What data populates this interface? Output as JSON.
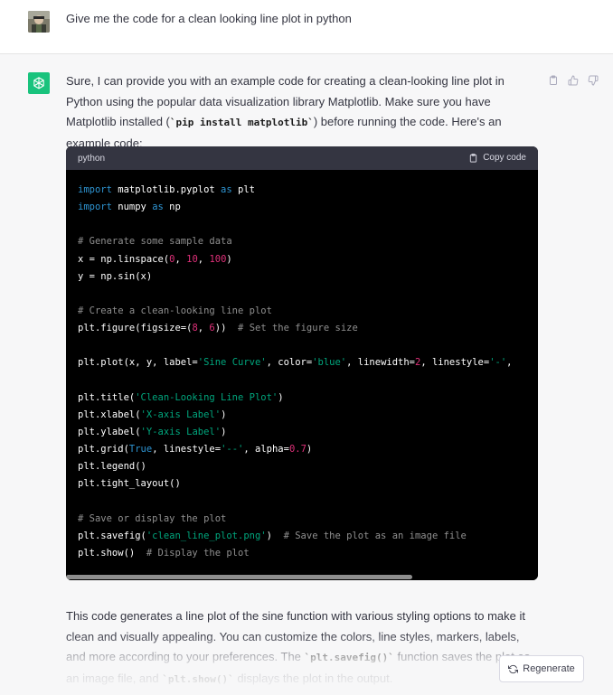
{
  "user_message": {
    "text": "Give me the code for a clean looking line plot in python"
  },
  "assistant": {
    "intro": {
      "text1": "Sure, I can provide you with an example code for creating a clean-looking line plot in Python using the popular data visualization library Matplotlib. Make sure you have Matplotlib installed (",
      "code": "`pip install matplotlib`",
      "text2": ") before running the code. Here's an example code:"
    },
    "code_block": {
      "language": "python",
      "copy_label": "Copy code",
      "lines": [
        [
          [
            "kw",
            "import"
          ],
          [
            "id",
            " matplotlib.pyplot "
          ],
          [
            "kw",
            "as"
          ],
          [
            "id",
            " plt"
          ]
        ],
        [
          [
            "kw",
            "import"
          ],
          [
            "id",
            " numpy "
          ],
          [
            "kw",
            "as"
          ],
          [
            "id",
            " np"
          ]
        ],
        [],
        [
          [
            "cm",
            "# Generate some sample data"
          ]
        ],
        [
          [
            "id",
            "x = np.linspace("
          ],
          [
            "num",
            "0"
          ],
          [
            "id",
            ", "
          ],
          [
            "num",
            "10"
          ],
          [
            "id",
            ", "
          ],
          [
            "num",
            "100"
          ],
          [
            "id",
            ")"
          ]
        ],
        [
          [
            "id",
            "y = np.sin(x)"
          ]
        ],
        [],
        [
          [
            "cm",
            "# Create a clean-looking line plot"
          ]
        ],
        [
          [
            "id",
            "plt.figure(figsize=("
          ],
          [
            "num",
            "8"
          ],
          [
            "id",
            ", "
          ],
          [
            "num",
            "6"
          ],
          [
            "id",
            "))  "
          ],
          [
            "cm",
            "# Set the figure size"
          ]
        ],
        [],
        [
          [
            "id",
            "plt.plot(x, y, label="
          ],
          [
            "str",
            "'Sine Curve'"
          ],
          [
            "id",
            ", color="
          ],
          [
            "str",
            "'blue'"
          ],
          [
            "id",
            ", linewidth="
          ],
          [
            "num",
            "2"
          ],
          [
            "id",
            ", linestyle="
          ],
          [
            "str",
            "'-'"
          ],
          [
            "id",
            ","
          ]
        ],
        [],
        [
          [
            "id",
            "plt.title("
          ],
          [
            "str",
            "'Clean-Looking Line Plot'"
          ],
          [
            "id",
            ")"
          ]
        ],
        [
          [
            "id",
            "plt.xlabel("
          ],
          [
            "str",
            "'X-axis Label'"
          ],
          [
            "id",
            ")"
          ]
        ],
        [
          [
            "id",
            "plt.ylabel("
          ],
          [
            "str",
            "'Y-axis Label'"
          ],
          [
            "id",
            ")"
          ]
        ],
        [
          [
            "id",
            "plt.grid("
          ],
          [
            "kw",
            "True"
          ],
          [
            "id",
            ", linestyle="
          ],
          [
            "str",
            "'--'"
          ],
          [
            "id",
            ", alpha="
          ],
          [
            "num",
            "0.7"
          ],
          [
            "id",
            ")"
          ]
        ],
        [
          [
            "id",
            "plt.legend()"
          ]
        ],
        [
          [
            "id",
            "plt.tight_layout()"
          ]
        ],
        [],
        [
          [
            "cm",
            "# Save or display the plot"
          ]
        ],
        [
          [
            "id",
            "plt.savefig("
          ],
          [
            "str",
            "'clean_line_plot.png'"
          ],
          [
            "id",
            ")  "
          ],
          [
            "cm",
            "# Save the plot as an image file"
          ]
        ],
        [
          [
            "id",
            "plt.show()  "
          ],
          [
            "cm",
            "# Display the plot"
          ]
        ]
      ]
    },
    "outro": {
      "text1": "This code generates a line plot of the sine function with various styling options to make it clean and visually appealing. You can customize the colors, line styles, markers, labels, and more according to your preferences. The ",
      "code1": "`plt.savefig()`",
      "text2": " function saves the plot as an image file, and ",
      "code2": "`plt.show()`",
      "text3": " displays the plot in the output."
    }
  },
  "regenerate_label": "Regenerate",
  "colors": {
    "assistant_bg": "#f7f7f8",
    "gpt_green": "#19c37d",
    "code_bg": "#000000",
    "code_header": "#343541",
    "keyword": "#2e95d3",
    "string": "#00a67d",
    "number": "#df3079",
    "comment": "#8f8f8f"
  },
  "icons": {
    "user_avatar": "user-photo-avatar",
    "assistant_avatar": "openai-logo-icon",
    "copy": "clipboard-icon",
    "thumbs_up": "thumbs-up-icon",
    "thumbs_down": "thumbs-down-icon",
    "regenerate": "refresh-icon"
  }
}
